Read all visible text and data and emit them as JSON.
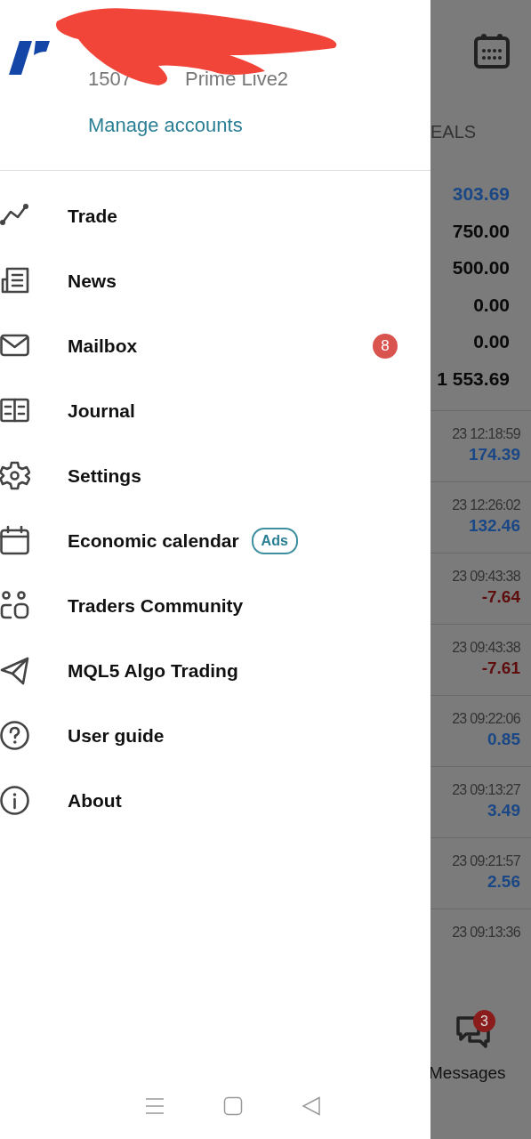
{
  "drawer": {
    "account_fragments": [
      "1507",
      "Prime Live2"
    ],
    "manage_link": "Manage accounts",
    "menu": [
      {
        "label": "Trade"
      },
      {
        "label": "News"
      },
      {
        "label": "Mailbox",
        "badge": "8"
      },
      {
        "label": "Journal"
      },
      {
        "label": "Settings"
      },
      {
        "label": "Economic calendar",
        "tag": "Ads"
      },
      {
        "label": "Traders Community"
      },
      {
        "label": "MQL5 Algo Trading"
      },
      {
        "label": "User guide"
      },
      {
        "label": "About"
      }
    ]
  },
  "background": {
    "header_fragment": "EALS",
    "summary": [
      {
        "value": "303.69",
        "color": "#1a4785"
      },
      {
        "value": "750.00",
        "color": "#0a0a0a"
      },
      {
        "value": "500.00",
        "color": "#0a0a0a"
      },
      {
        "value": "0.00",
        "color": "#0a0a0a"
      },
      {
        "value": "0.00",
        "color": "#0a0a0a"
      },
      {
        "value": "1 553.69",
        "color": "#0a0a0a"
      }
    ],
    "deals": [
      {
        "time": "23 12:18:59",
        "profit": "174.39",
        "color": "#1a4785"
      },
      {
        "time": "23 12:26:02",
        "profit": "132.46",
        "color": "#1a4785"
      },
      {
        "time": "23 09:43:38",
        "profit": "-7.64",
        "color": "#5e0c0c"
      },
      {
        "time": "23 09:43:38",
        "profit": "-7.61",
        "color": "#5e0c0c"
      },
      {
        "time": "23 09:22:06",
        "profit": "0.85",
        "color": "#1a4785"
      },
      {
        "time": "23 09:13:27",
        "profit": "3.49",
        "color": "#1a4785"
      },
      {
        "time": "23 09:21:57",
        "profit": "2.56",
        "color": "#1a4785"
      },
      {
        "time": "23 09:13:36"
      }
    ],
    "messages": {
      "label": "Messages",
      "badge": "3"
    }
  }
}
